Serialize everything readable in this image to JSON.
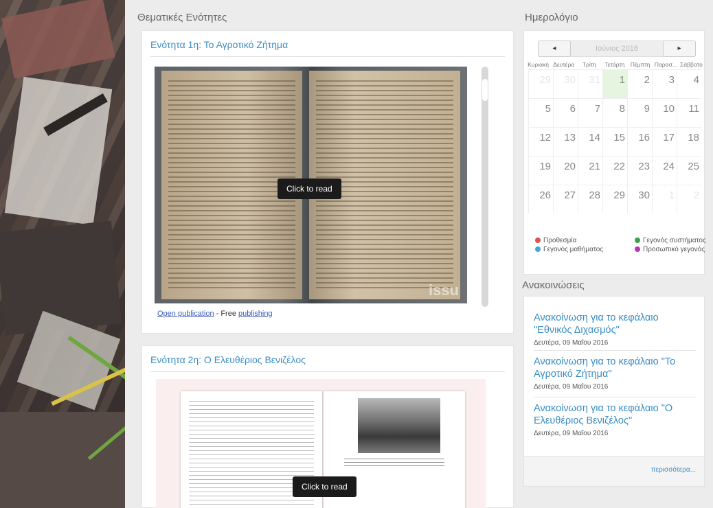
{
  "main": {
    "section_title": "Θεματικές Ενότητες",
    "unit1": {
      "title": "Ενότητα 1η: Το Αγροτικό Ζήτημα",
      "click_label": "Click to read",
      "watermark": "issu",
      "open_label": "Open publication",
      "free_text": " - Free ",
      "publishing_label": "publishing"
    },
    "unit2": {
      "title": "Ενότητα 2η: Ο Ελευθέριος Βενιζέλος",
      "click_label": "Click to read"
    }
  },
  "calendar": {
    "title": "Ημερολόγιο",
    "prev": "◂",
    "next": "▸",
    "month": "Ιούνιος 2016",
    "days_of_week": [
      "Κυριακή",
      "Δευτέρα",
      "Τρίτη",
      "Τετάρτη",
      "Πέμπτη",
      "Παρασ...",
      "Σάββατο"
    ],
    "weeks": [
      [
        {
          "d": "29",
          "o": true
        },
        {
          "d": "30",
          "o": true
        },
        {
          "d": "31",
          "o": true
        },
        {
          "d": "1",
          "t": true
        },
        {
          "d": "2"
        },
        {
          "d": "3"
        },
        {
          "d": "4"
        }
      ],
      [
        {
          "d": "5"
        },
        {
          "d": "6"
        },
        {
          "d": "7"
        },
        {
          "d": "8"
        },
        {
          "d": "9"
        },
        {
          "d": "10"
        },
        {
          "d": "11"
        }
      ],
      [
        {
          "d": "12"
        },
        {
          "d": "13"
        },
        {
          "d": "14"
        },
        {
          "d": "15"
        },
        {
          "d": "16"
        },
        {
          "d": "17"
        },
        {
          "d": "18"
        }
      ],
      [
        {
          "d": "19"
        },
        {
          "d": "20"
        },
        {
          "d": "21"
        },
        {
          "d": "22"
        },
        {
          "d": "23"
        },
        {
          "d": "24"
        },
        {
          "d": "25"
        }
      ],
      [
        {
          "d": "26"
        },
        {
          "d": "27"
        },
        {
          "d": "28"
        },
        {
          "d": "29"
        },
        {
          "d": "30"
        },
        {
          "d": "1",
          "o": true
        },
        {
          "d": "2",
          "o": true
        }
      ]
    ],
    "legend": {
      "deadline": "Προθεσμία",
      "system_event": "Γεγονός συστήματος",
      "course_event": "Γεγονός μαθήματος",
      "personal_event": "Προσωπικό γεγονός"
    },
    "colors": {
      "deadline": "#d9534f",
      "system_event": "#3aa04a",
      "course_event": "#41a6e0",
      "personal_event": "#b03ab8"
    }
  },
  "announcements": {
    "title": "Ανακοινώσεις",
    "items": [
      {
        "title": "Ανακοίνωση για το κεφάλαιο \"Εθνικός Διχασμός\"",
        "date": "Δευτέρα, 09 Μαΐου 2016"
      },
      {
        "title": "Ανακοίνωση για το κεφάλαιο \"Το Αγροτικό Ζήτημα\"",
        "date": "Δευτέρα, 09 Μαΐου 2016"
      },
      {
        "title": "Ανακοίνωση για το κεφάλαιο \"Ο Ελευθέριος Βενιζέλος\"",
        "date": "Δευτέρα, 09 Μαΐου 2016"
      }
    ],
    "more": "περισσότερα..."
  }
}
